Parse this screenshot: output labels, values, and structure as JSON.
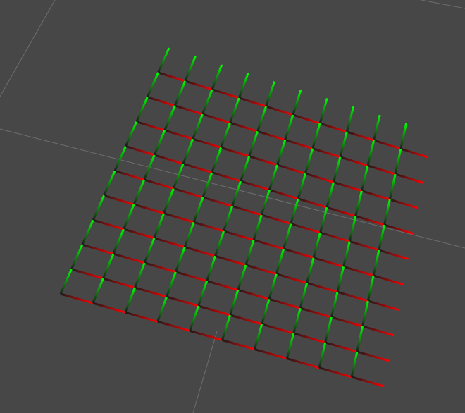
{
  "viewport": {
    "background_color": "#474747",
    "floor_grid_color": "#6e6e6e"
  },
  "axes_markers": {
    "rows": 10,
    "columns": 10,
    "x_axis_color": "#ff0000",
    "y_axis_color": "#00ff00",
    "origin_color": "#1a1a1a"
  }
}
